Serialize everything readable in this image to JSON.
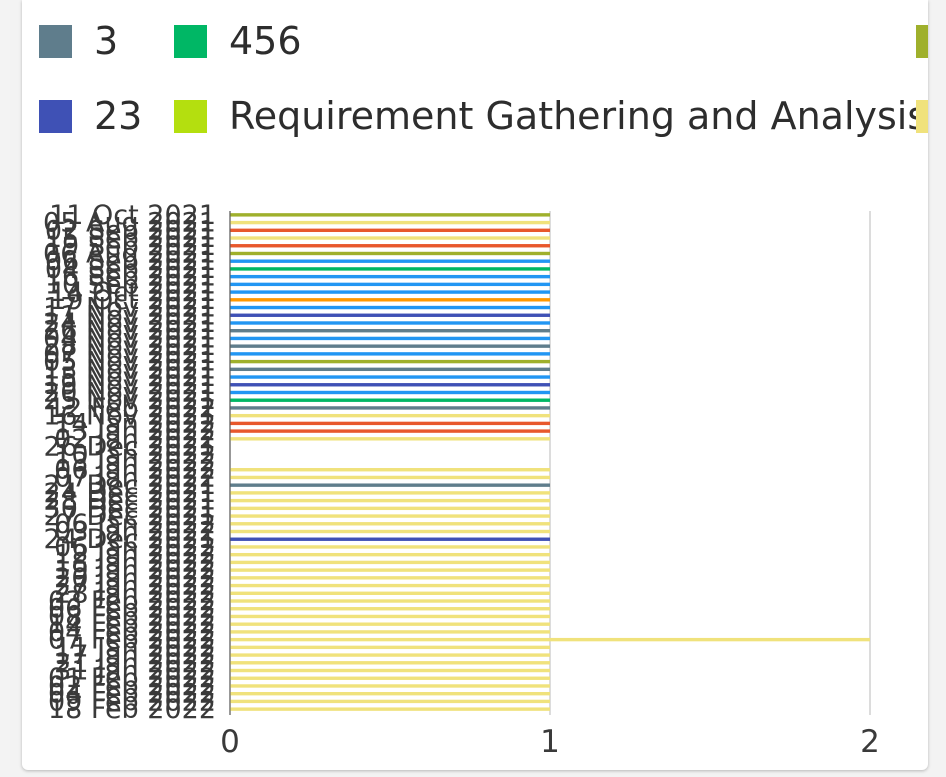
{
  "colors": {
    "slate": "#5f7d8c",
    "green": "#00b765",
    "olive": "#9fb02c",
    "indigo": "#3f51b5",
    "lime": "#b4df0f",
    "yellow": "#f0e27c",
    "orange": "#e8582c",
    "blue": "#2196f3",
    "amber": "#ff9800"
  },
  "chart_data": {
    "type": "bar",
    "orientation": "horizontal",
    "legend_placement": "top",
    "legend": [
      {
        "label": "3",
        "color": "#5f7d8c"
      },
      {
        "label": "456",
        "color": "#00b765"
      },
      {
        "label": "",
        "color": "#9fb02c"
      },
      {
        "label": "23",
        "color": "#3f51b5"
      },
      {
        "label": "Requirement Gathering and Analysis",
        "color": "#b4df0f"
      },
      {
        "label": "",
        "color": "#f0e27c"
      }
    ],
    "categories": [
      "11 Oct 2021",
      "05 Aug 2021",
      "02 Sep 2021",
      "15 Sep 2021",
      "19 Sep 2021",
      "06 Aug 2021",
      "06 Sep 2021",
      "04 Sep 2021",
      "16 Sep 2021",
      "10 Sep 2021",
      "14 Oct 2021",
      "19 Oct 2021",
      "17 Nov 2021",
      "11 Nov 2021",
      "24 Nov 2021",
      "26 Nov 2021",
      "04 Nov 2021",
      "28 Nov 2021",
      "07 Nov 2021",
      "05 Nov 2021",
      "13 Nov 2021",
      "15 Nov 2021",
      "19 Nov 2021",
      "20 Nov 2021",
      "25 Nov 2021",
      "12 Feb 2022",
      "16 Nov 2021",
      "14 Jan 2022",
      "13 Jan 2022",
      "02 Jan 2022",
      "26 Dec 2021",
      "10 Jan 2022",
      "13 Jan 2022",
      "06 Jan 2022",
      "07 Jan 2022",
      "21 Dec 2021",
      "24 Dec 2021",
      "28 Dec 2021",
      "30 Dec 2021",
      "27 Dec 2021",
      "06 Jan 2022",
      "03 Jan 2022",
      "24 Dec 2021",
      "06 Jan 2022",
      "12 Jan 2022",
      "18 Jan 2022",
      "19 Jan 2022",
      "20 Jan 2022",
      "27 Jan 2022",
      "28 Jan 2022",
      "03 Feb 2022",
      "06 Feb 2022",
      "08 Feb 2022",
      "14 Feb 2022",
      "04 Feb 2022",
      "07 Feb 2022",
      "11 Jan 2022",
      "17 Jan 2022",
      "21 Jan 2022",
      "31 Jan 2022",
      "01 Feb 2022",
      "02 Feb 2022",
      "04 Feb 2022",
      "09 Feb 2022",
      "18 Feb 2022"
    ],
    "values": [
      1,
      1,
      1,
      1,
      1,
      1,
      1,
      1,
      1,
      1,
      1,
      1,
      1,
      1,
      1,
      1,
      1,
      1,
      1,
      1,
      1,
      1,
      1,
      1,
      1,
      1,
      1,
      1,
      1,
      1,
      0,
      0,
      0,
      1,
      1,
      1,
      1,
      1,
      1,
      1,
      1,
      1,
      1,
      1,
      1,
      1,
      1,
      1,
      1,
      1,
      1,
      1,
      1,
      1,
      1,
      2,
      1,
      1,
      1,
      1,
      1,
      1,
      1,
      1,
      1
    ],
    "bar_colors": [
      "#9fb02c",
      "#f0e27c",
      "#e8582c",
      "#f0e27c",
      "#e8582c",
      "#9fb02c",
      "#2196f3",
      "#00b765",
      "#2196f3",
      "#2196f3",
      "#2196f3",
      "#ff9800",
      "#2196f3",
      "#3f51b5",
      "#2196f3",
      "#5f7d8c",
      "#2196f3",
      "#5f7d8c",
      "#2196f3",
      "#9fb02c",
      "#5f7d8c",
      "#2196f3",
      "#3f51b5",
      "#2196f3",
      "#00b765",
      "#5f7d8c",
      "#f0e27c",
      "#e8582c",
      "#e8582c",
      "#f0e27c",
      "#f0e27c",
      "#f0e27c",
      "#f0e27c",
      "#f0e27c",
      "#f0e27c",
      "#5f7d8c",
      "#f0e27c",
      "#f0e27c",
      "#f0e27c",
      "#f0e27c",
      "#f0e27c",
      "#f0e27c",
      "#3f51b5",
      "#f0e27c",
      "#f0e27c",
      "#f0e27c",
      "#f0e27c",
      "#f0e27c",
      "#f0e27c",
      "#f0e27c",
      "#f0e27c",
      "#f0e27c",
      "#f0e27c",
      "#f0e27c",
      "#f0e27c",
      "#f0e27c",
      "#f0e27c",
      "#f0e27c",
      "#f0e27c",
      "#f0e27c",
      "#f0e27c",
      "#f0e27c",
      "#f0e27c",
      "#f0e27c",
      "#f0e27c"
    ],
    "x_ticks": [
      "0",
      "1",
      "2"
    ],
    "xlim": [
      0,
      2
    ],
    "grid": true,
    "title": "",
    "xlabel": "",
    "ylabel": ""
  }
}
